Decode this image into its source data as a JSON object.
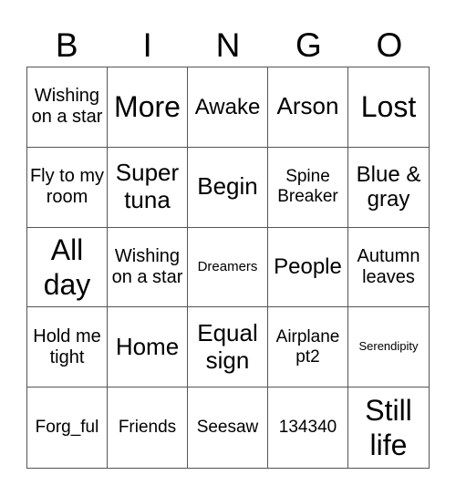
{
  "header": [
    "B",
    "I",
    "N",
    "G",
    "O"
  ],
  "cells": [
    [
      "Wishing on a star",
      "More",
      "Awake",
      "Arson",
      "Lost"
    ],
    [
      "Fly to my room",
      "Super tuna",
      "Begin",
      "Spine Breaker",
      "Blue & gray"
    ],
    [
      "All day",
      "Wishing on a star",
      "Dreamers",
      "People",
      "Autumn leaves"
    ],
    [
      "Hold me tight",
      "Home",
      "Equal sign",
      "Airplane pt2",
      "Serendipity"
    ],
    [
      "Forg_ful",
      "Friends",
      "Seesaw",
      "134340",
      "Still life"
    ]
  ]
}
